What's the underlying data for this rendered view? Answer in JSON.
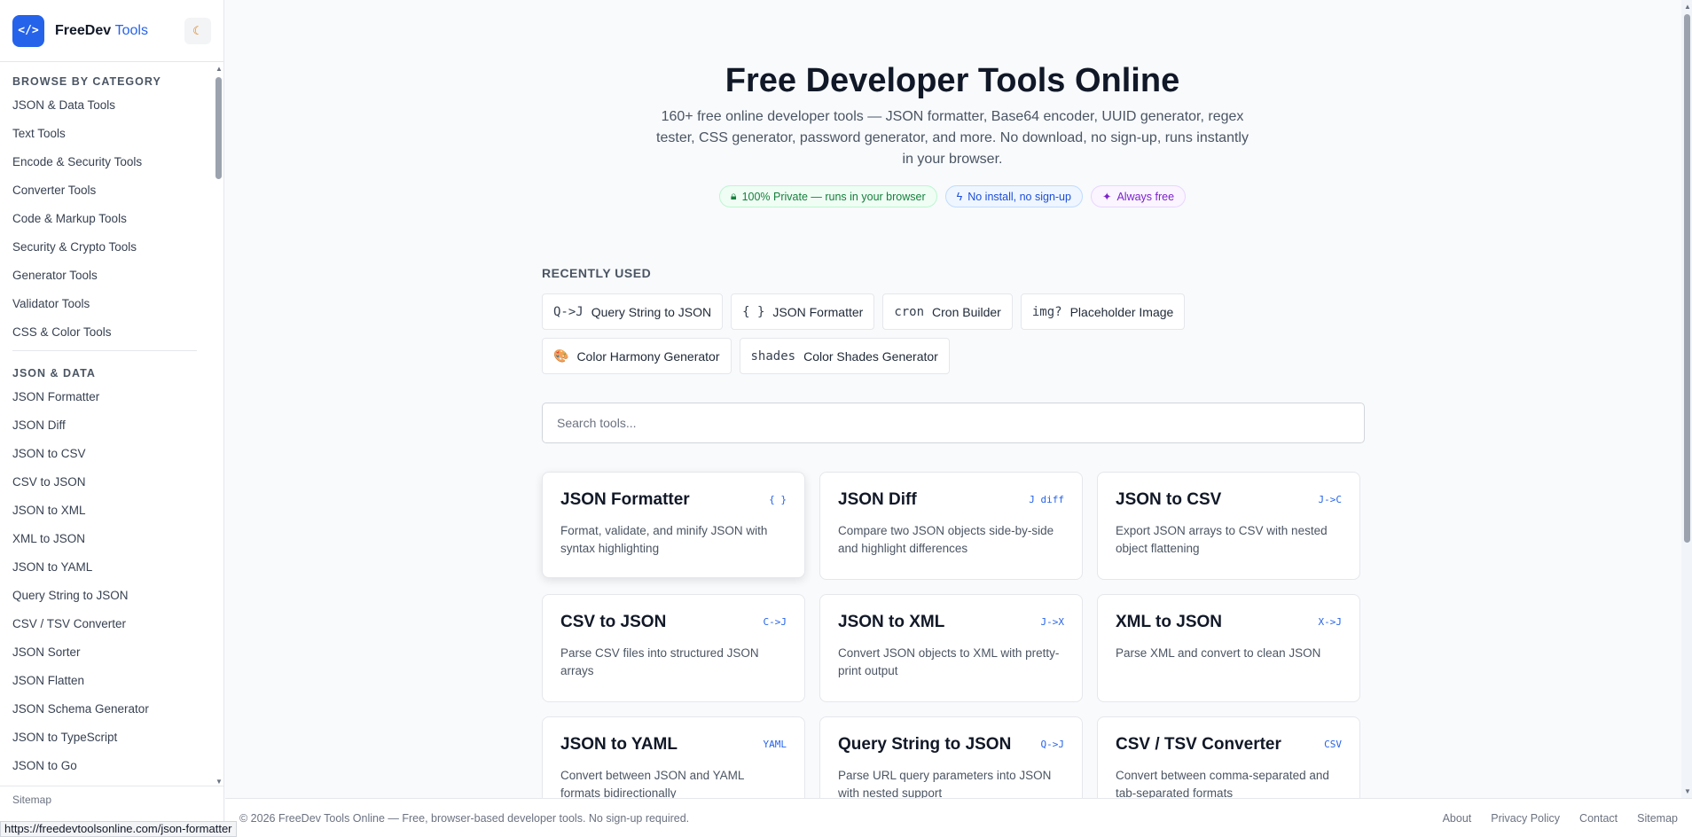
{
  "sidebar": {
    "brand_name": "FreeDev",
    "brand_accent": "Tools",
    "logo_text": "</>",
    "theme_icon": "☾",
    "category_title": "BROWSE BY CATEGORY",
    "categories": [
      "JSON & Data Tools",
      "Text Tools",
      "Encode & Security Tools",
      "Converter Tools",
      "Code & Markup Tools",
      "Security & Crypto Tools",
      "Generator Tools",
      "Validator Tools",
      "CSS & Color Tools"
    ],
    "section_title": "JSON & DATA",
    "section_items": [
      "JSON Formatter",
      "JSON Diff",
      "JSON to CSV",
      "CSV to JSON",
      "JSON to XML",
      "XML to JSON",
      "JSON to YAML",
      "Query String to JSON",
      "CSV / TSV Converter",
      "JSON Sorter",
      "JSON Flatten",
      "JSON Schema Generator",
      "JSON to TypeScript",
      "JSON to Go"
    ],
    "footer_link": "Sitemap"
  },
  "hero": {
    "title": "Free Developer Tools Online",
    "subtitle": "160+ free online developer tools — JSON formatter, Base64 encoder, UUID generator, regex tester, CSS generator, password generator, and more. No download, no sign-up, runs instantly in your browser.",
    "badges": [
      {
        "icon": "lock-icon",
        "glyph": "🔒︎",
        "label": "100% Private — runs in your browser"
      },
      {
        "icon": "lightning-icon",
        "glyph": "ϟ",
        "label": "No install, no sign-up"
      },
      {
        "icon": "sparkle-icon",
        "glyph": "✦",
        "label": "Always free"
      }
    ]
  },
  "recent": {
    "title": "RECENTLY USED",
    "row1": [
      {
        "icon": "Q->J",
        "label": "Query String to JSON"
      },
      {
        "icon": "{ }",
        "label": "JSON Formatter"
      },
      {
        "icon": "cron",
        "label": "Cron Builder"
      },
      {
        "icon": "img?",
        "label": "Placeholder Image"
      }
    ],
    "row2": [
      {
        "icon": "🎨",
        "label": "Color Harmony Generator"
      },
      {
        "icon": "shades",
        "label": "Color Shades Generator"
      }
    ]
  },
  "search": {
    "placeholder": "Search tools..."
  },
  "tools": [
    {
      "title": "JSON Formatter",
      "tag": "{ }",
      "desc": "Format, validate, and minify JSON with syntax highlighting"
    },
    {
      "title": "JSON Diff",
      "tag": "J diff",
      "desc": "Compare two JSON objects side-by-side and highlight differences"
    },
    {
      "title": "JSON to CSV",
      "tag": "J->C",
      "desc": "Export JSON arrays to CSV with nested object flattening"
    },
    {
      "title": "CSV to JSON",
      "tag": "C->J",
      "desc": "Parse CSV files into structured JSON arrays"
    },
    {
      "title": "JSON to XML",
      "tag": "J->X",
      "desc": "Convert JSON objects to XML with pretty-print output"
    },
    {
      "title": "XML to JSON",
      "tag": "X->J",
      "desc": "Parse XML and convert to clean JSON"
    },
    {
      "title": "JSON to YAML",
      "tag": "YAML",
      "desc": "Convert between JSON and YAML formats bidirectionally"
    },
    {
      "title": "Query String to JSON",
      "tag": "Q->J",
      "desc": "Parse URL query parameters into JSON with nested support"
    },
    {
      "title": "CSV / TSV Converter",
      "tag": "CSV",
      "desc": "Convert between comma-separated and tab-separated formats"
    }
  ],
  "footer": {
    "copyright": "© 2026 FreeDev Tools Online — Free, browser-based developer tools. No sign-up required.",
    "links": [
      "About",
      "Privacy Policy",
      "Contact",
      "Sitemap"
    ]
  },
  "status_url": "https://freedevtoolsonline.com/json-formatter",
  "colors": {
    "accent": "#2563eb",
    "background": "#f8fafc",
    "badge_green": "#15803d",
    "badge_blue": "#1d4ed8",
    "badge_purple": "#7e22ce"
  }
}
